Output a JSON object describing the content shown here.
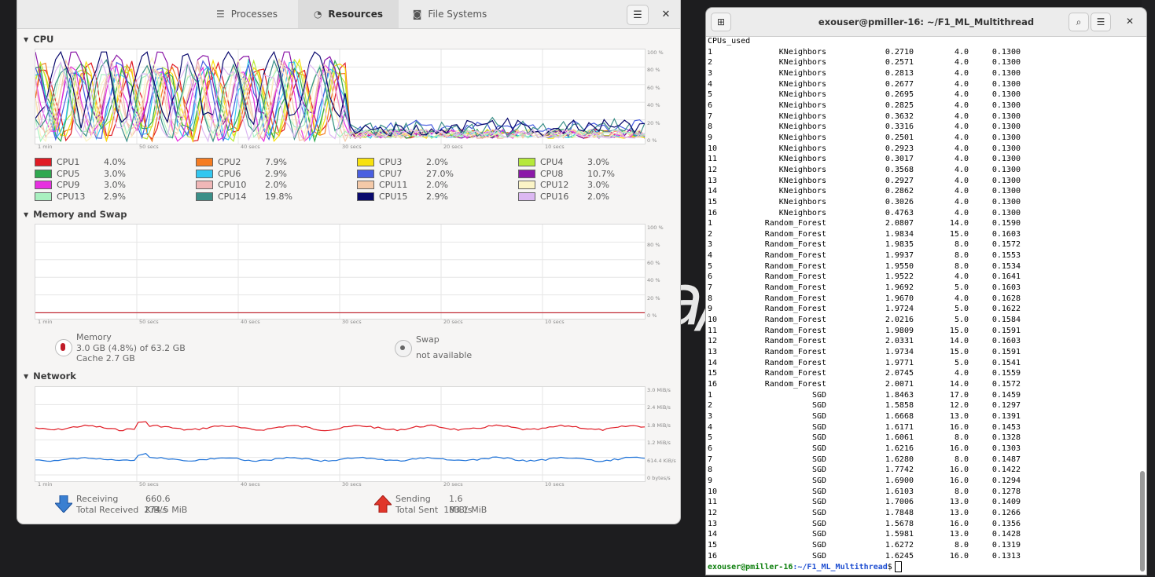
{
  "system_monitor": {
    "tabs": [
      {
        "label": "Processes",
        "icon": "list-icon"
      },
      {
        "label": "Resources",
        "icon": "gauge-icon"
      },
      {
        "label": "File Systems",
        "icon": "disk-icon"
      }
    ],
    "active_tab": "Resources",
    "cpu": {
      "title": "CPU",
      "y_ticks": [
        "100 %",
        "80 %",
        "60 %",
        "40 %",
        "20 %",
        "0 %"
      ],
      "x_ticks": [
        "1 min",
        "50 secs",
        "40 secs",
        "30 secs",
        "20 secs",
        "10 secs"
      ],
      "cores": [
        {
          "label": "CPU1",
          "value": "4.0%",
          "color": "#e01b24"
        },
        {
          "label": "CPU2",
          "value": "7.9%",
          "color": "#f57c21"
        },
        {
          "label": "CPU3",
          "value": "2.0%",
          "color": "#f7e10e"
        },
        {
          "label": "CPU4",
          "value": "3.0%",
          "color": "#b5e83a"
        },
        {
          "label": "CPU5",
          "value": "3.0%",
          "color": "#2fa84f"
        },
        {
          "label": "CPU6",
          "value": "2.9%",
          "color": "#33c7f0"
        },
        {
          "label": "CPU7",
          "value": "27.0%",
          "color": "#4a5fe0"
        },
        {
          "label": "CPU8",
          "value": "10.7%",
          "color": "#8b19a8"
        },
        {
          "label": "CPU9",
          "value": "3.0%",
          "color": "#e630e0"
        },
        {
          "label": "CPU10",
          "value": "2.0%",
          "color": "#f0b7b7"
        },
        {
          "label": "CPU11",
          "value": "2.0%",
          "color": "#f4c9a8"
        },
        {
          "label": "CPU12",
          "value": "3.0%",
          "color": "#fbf4c6"
        },
        {
          "label": "CPU13",
          "value": "2.9%",
          "color": "#a9f0c0"
        },
        {
          "label": "CPU14",
          "value": "19.8%",
          "color": "#3b8f88"
        },
        {
          "label": "CPU15",
          "value": "2.9%",
          "color": "#0a0a6e"
        },
        {
          "label": "CPU16",
          "value": "2.0%",
          "color": "#dcb8f2"
        }
      ]
    },
    "memory": {
      "title": "Memory and Swap",
      "y_ticks": [
        "100 %",
        "80 %",
        "60 %",
        "40 %",
        "20 %",
        "0 %"
      ],
      "x_ticks": [
        "1 min",
        "50 secs",
        "40 secs",
        "30 secs",
        "20 secs",
        "10 secs"
      ],
      "memory_label": "Memory",
      "memory_used": "3.0 GB (4.8%) of 63.2 GB",
      "cache": "Cache 2.7 GB",
      "swap_label": "Swap",
      "swap_value": "not available",
      "memory_percent": 4.8
    },
    "network": {
      "title": "Network",
      "y_ticks": [
        "3.0 MiB/s",
        "2.4 MiB/s",
        "1.8 MiB/s",
        "1.2 MiB/s",
        "614.4 KiB/s",
        "0 bytes/s"
      ],
      "x_ticks": [
        "1 min",
        "50 secs",
        "40 secs",
        "30 secs",
        "20 secs",
        "10 secs"
      ],
      "receiving_label": "Receiving",
      "receiving_value": "660.6 KiB/s",
      "total_received_label": "Total Received",
      "total_received_value": "274.5 MiB",
      "sending_label": "Sending",
      "sending_value": "1.6 MiB/s",
      "total_sent_label": "Total Sent",
      "total_sent_value": "183.1 MiB",
      "receive_color": "#1c71d8",
      "send_color": "#e01b24"
    }
  },
  "terminal": {
    "title": "exouser@pmiller-16: ~/F1_ML_Multithread",
    "header_line": "CPUs_used",
    "rows": [
      [
        "1",
        "KNeighbors",
        "0.2710",
        "4.0",
        "0.1300"
      ],
      [
        "2",
        "KNeighbors",
        "0.2571",
        "4.0",
        "0.1300"
      ],
      [
        "3",
        "KNeighbors",
        "0.2813",
        "4.0",
        "0.1300"
      ],
      [
        "4",
        "KNeighbors",
        "0.2677",
        "4.0",
        "0.1300"
      ],
      [
        "5",
        "KNeighbors",
        "0.2695",
        "4.0",
        "0.1300"
      ],
      [
        "6",
        "KNeighbors",
        "0.2825",
        "4.0",
        "0.1300"
      ],
      [
        "7",
        "KNeighbors",
        "0.3632",
        "4.0",
        "0.1300"
      ],
      [
        "8",
        "KNeighbors",
        "0.3316",
        "4.0",
        "0.1300"
      ],
      [
        "9",
        "KNeighbors",
        "0.2501",
        "4.0",
        "0.1300"
      ],
      [
        "10",
        "KNeighbors",
        "0.2923",
        "4.0",
        "0.1300"
      ],
      [
        "11",
        "KNeighbors",
        "0.3017",
        "4.0",
        "0.1300"
      ],
      [
        "12",
        "KNeighbors",
        "0.3568",
        "4.0",
        "0.1300"
      ],
      [
        "13",
        "KNeighbors",
        "0.2927",
        "4.0",
        "0.1300"
      ],
      [
        "14",
        "KNeighbors",
        "0.2862",
        "4.0",
        "0.1300"
      ],
      [
        "15",
        "KNeighbors",
        "0.3026",
        "4.0",
        "0.1300"
      ],
      [
        "16",
        "KNeighbors",
        "0.4763",
        "4.0",
        "0.1300"
      ],
      [
        "1",
        "Random_Forest",
        "2.0807",
        "14.0",
        "0.1590"
      ],
      [
        "2",
        "Random_Forest",
        "1.9834",
        "15.0",
        "0.1603"
      ],
      [
        "3",
        "Random_Forest",
        "1.9835",
        "8.0",
        "0.1572"
      ],
      [
        "4",
        "Random_Forest",
        "1.9937",
        "8.0",
        "0.1553"
      ],
      [
        "5",
        "Random_Forest",
        "1.9550",
        "8.0",
        "0.1534"
      ],
      [
        "6",
        "Random_Forest",
        "1.9522",
        "4.0",
        "0.1641"
      ],
      [
        "7",
        "Random_Forest",
        "1.9692",
        "5.0",
        "0.1603"
      ],
      [
        "8",
        "Random_Forest",
        "1.9670",
        "4.0",
        "0.1628"
      ],
      [
        "9",
        "Random_Forest",
        "1.9724",
        "5.0",
        "0.1622"
      ],
      [
        "10",
        "Random_Forest",
        "2.0216",
        "5.0",
        "0.1584"
      ],
      [
        "11",
        "Random_Forest",
        "1.9809",
        "15.0",
        "0.1591"
      ],
      [
        "12",
        "Random_Forest",
        "2.0331",
        "14.0",
        "0.1603"
      ],
      [
        "13",
        "Random_Forest",
        "1.9734",
        "15.0",
        "0.1591"
      ],
      [
        "14",
        "Random_Forest",
        "1.9771",
        "5.0",
        "0.1541"
      ],
      [
        "15",
        "Random_Forest",
        "2.0745",
        "4.0",
        "0.1559"
      ],
      [
        "16",
        "Random_Forest",
        "2.0071",
        "14.0",
        "0.1572"
      ],
      [
        "1",
        "SGD",
        "1.8463",
        "17.0",
        "0.1459"
      ],
      [
        "2",
        "SGD",
        "1.5858",
        "12.0",
        "0.1297"
      ],
      [
        "3",
        "SGD",
        "1.6668",
        "13.0",
        "0.1391"
      ],
      [
        "4",
        "SGD",
        "1.6171",
        "16.0",
        "0.1453"
      ],
      [
        "5",
        "SGD",
        "1.6061",
        "8.0",
        "0.1328"
      ],
      [
        "6",
        "SGD",
        "1.6216",
        "16.0",
        "0.1303"
      ],
      [
        "7",
        "SGD",
        "1.6280",
        "8.0",
        "0.1487"
      ],
      [
        "8",
        "SGD",
        "1.7742",
        "16.0",
        "0.1422"
      ],
      [
        "9",
        "SGD",
        "1.6900",
        "16.0",
        "0.1294"
      ],
      [
        "10",
        "SGD",
        "1.6103",
        "8.0",
        "0.1278"
      ],
      [
        "11",
        "SGD",
        "1.7006",
        "13.0",
        "0.1409"
      ],
      [
        "12",
        "SGD",
        "1.7848",
        "13.0",
        "0.1266"
      ],
      [
        "13",
        "SGD",
        "1.5678",
        "16.0",
        "0.1356"
      ],
      [
        "14",
        "SGD",
        "1.5981",
        "13.0",
        "0.1428"
      ],
      [
        "15",
        "SGD",
        "1.6272",
        "8.0",
        "0.1319"
      ],
      [
        "16",
        "SGD",
        "1.6245",
        "16.0",
        "0.1313"
      ]
    ],
    "prompt_user": "exouser@pmiller-16",
    "prompt_path": ":~/F1_ML_Multithread",
    "prompt_symbol": "$"
  }
}
